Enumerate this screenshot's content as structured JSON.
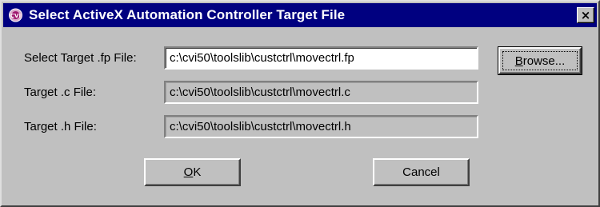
{
  "window": {
    "title": "Select ActiveX Automation Controller Target File",
    "icon": "cvi-app-icon",
    "close_label": "×"
  },
  "form": {
    "fp_label": "Select Target .fp File:",
    "fp_value": "c:\\cvi50\\toolslib\\custctrl\\movectrl.fp",
    "c_label": "Target .c File:",
    "c_value": "c:\\cvi50\\toolslib\\custctrl\\movectrl.c",
    "h_label": "Target .h File:",
    "h_value": "c:\\cvi50\\toolslib\\custctrl\\movectrl.h"
  },
  "buttons": {
    "browse_mnemonic": "B",
    "browse_rest": "rowse...",
    "ok_mnemonic": "O",
    "ok_rest": "K",
    "cancel": "Cancel"
  },
  "colors": {
    "titlebar": "#000080",
    "face": "#c0c0c0",
    "field_editable": "#ffffff"
  }
}
